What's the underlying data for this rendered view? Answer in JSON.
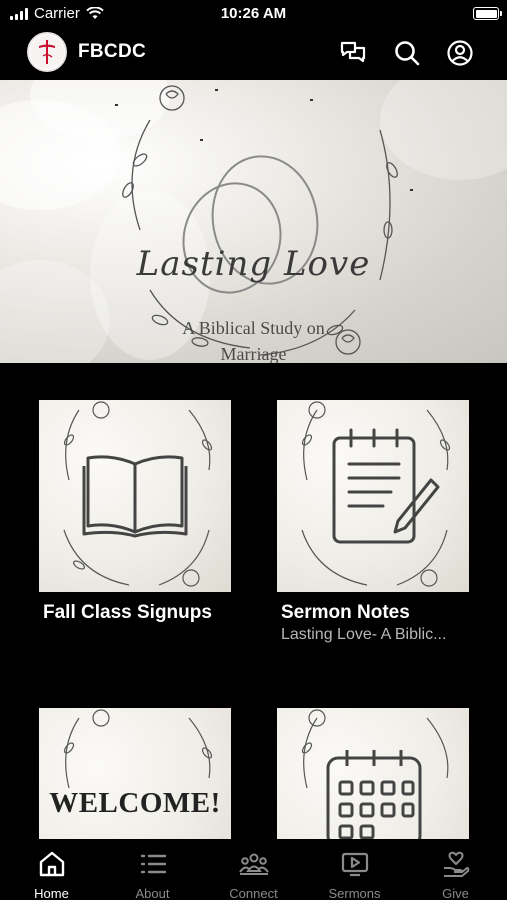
{
  "status_bar": {
    "carrier": "Carrier",
    "time": "10:26 AM"
  },
  "header": {
    "title": "FBCDC",
    "icons": [
      "chat-icon",
      "search-icon",
      "account-icon"
    ]
  },
  "hero": {
    "title": "Lasting Love",
    "subtitle_line1": "A Biblical Study on",
    "subtitle_line2": "Marriage"
  },
  "cards": [
    {
      "title": "Fall Class Signups",
      "subtitle": "",
      "image_icon": "open-book-icon"
    },
    {
      "title": "Sermon Notes",
      "subtitle": "Lasting Love- A Biblic...",
      "image_icon": "notepad-pencil-icon"
    },
    {
      "title": "",
      "subtitle": "",
      "image_text": "WELCOME!"
    },
    {
      "title": "",
      "subtitle": "",
      "image_icon": "calendar-icon"
    }
  ],
  "tabs": [
    {
      "label": "Home",
      "icon": "home-icon",
      "active": true
    },
    {
      "label": "About",
      "icon": "list-icon",
      "active": false
    },
    {
      "label": "Connect",
      "icon": "people-icon",
      "active": false
    },
    {
      "label": "Sermons",
      "icon": "video-icon",
      "active": false
    },
    {
      "label": "Give",
      "icon": "heart-hand-icon",
      "active": false
    }
  ],
  "colors": {
    "background": "#000000",
    "text": "#ffffff",
    "inactive_tab": "#8a8a8a",
    "subtitle": "#b8b8b8",
    "logo_accent": "#c8102e"
  }
}
